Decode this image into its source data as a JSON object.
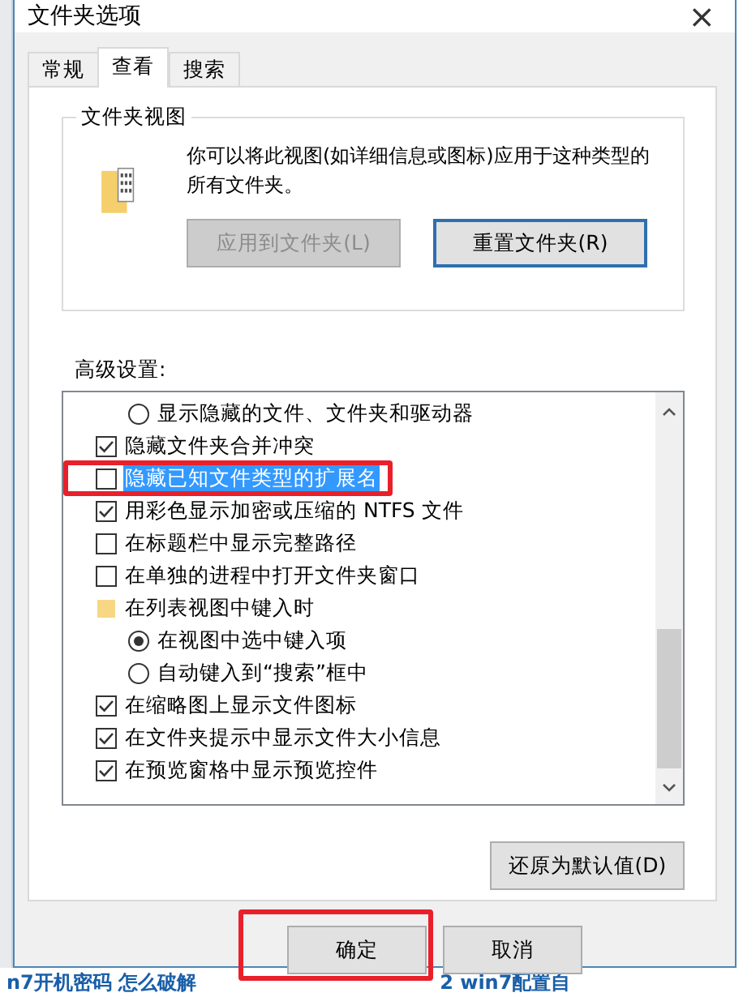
{
  "window": {
    "title": "文件夹选项",
    "close": "×"
  },
  "tabs": [
    {
      "label": "常规",
      "selected": false
    },
    {
      "label": "查看",
      "selected": true
    },
    {
      "label": "搜索",
      "selected": false
    }
  ],
  "folder_views": {
    "title": "文件夹视图",
    "description": "你可以将此视图(如详细信息或图标)应用于这种类型的所有文件夹。",
    "buttons": [
      {
        "label": "应用到文件夹(L)",
        "disabled": true,
        "focused": false
      },
      {
        "label": "重置文件夹(R)",
        "disabled": false,
        "focused": true
      }
    ]
  },
  "advanced": {
    "label": "高级设置:",
    "items": [
      {
        "kind": "radio",
        "label": "显示隐藏的文件、文件夹和驱动器",
        "checked": false,
        "selected": false,
        "highlighted": false
      },
      {
        "kind": "checkbox",
        "label": "隐藏文件夹合并冲突",
        "checked": true,
        "selected": false,
        "highlighted": false
      },
      {
        "kind": "checkbox",
        "label": "隐藏已知文件类型的扩展名",
        "checked": false,
        "selected": true,
        "highlighted": true
      },
      {
        "kind": "checkbox",
        "label": "用彩色显示加密或压缩的 NTFS 文件",
        "checked": true,
        "selected": false,
        "highlighted": false
      },
      {
        "kind": "checkbox",
        "label": "在标题栏中显示完整路径",
        "checked": false,
        "selected": false,
        "highlighted": false
      },
      {
        "kind": "checkbox",
        "label": "在单独的进程中打开文件夹窗口",
        "checked": false,
        "selected": false,
        "highlighted": false
      },
      {
        "kind": "folder",
        "label": "在列表视图中键入时",
        "selected": false,
        "highlighted": false
      },
      {
        "kind": "radio",
        "label": "在视图中选中键入项",
        "checked": true,
        "selected": false,
        "highlighted": false
      },
      {
        "kind": "radio",
        "label": "自动键入到“搜索”框中",
        "checked": false,
        "selected": false,
        "highlighted": false
      },
      {
        "kind": "checkbox",
        "label": "在缩略图上显示文件图标",
        "checked": true,
        "selected": false,
        "highlighted": false
      },
      {
        "kind": "checkbox",
        "label": "在文件夹提示中显示文件大小信息",
        "checked": true,
        "selected": false,
        "highlighted": false
      },
      {
        "kind": "checkbox",
        "label": "在预览窗格中显示预览控件",
        "checked": true,
        "selected": false,
        "highlighted": false
      }
    ],
    "restore_button": "还原为默认值(D)"
  },
  "footer_buttons": [
    {
      "label": "确定",
      "highlighted": true
    },
    {
      "label": "取消"
    }
  ],
  "background_links": [
    "n7开机密码 怎么破解",
    "2  win7配置自"
  ]
}
